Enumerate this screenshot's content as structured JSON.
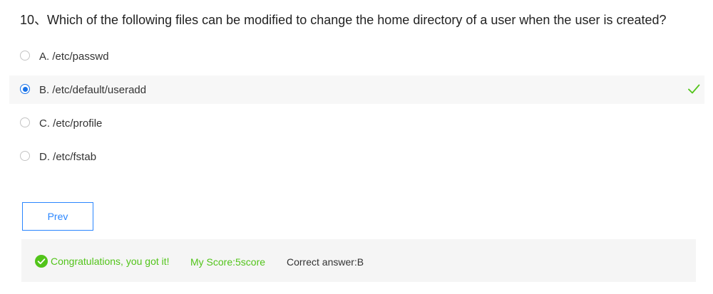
{
  "question": {
    "text": "10、Which of the following files can be modified to change the home directory of a user when the user is created?"
  },
  "options": [
    {
      "label": "A. /etc/passwd",
      "selected": false
    },
    {
      "label": "B. /etc/default/useradd",
      "selected": true,
      "correct_mark": true
    },
    {
      "label": "C. /etc/profile",
      "selected": false
    },
    {
      "label": "D. /etc/fstab",
      "selected": false
    }
  ],
  "prev_button": {
    "label": "Prev"
  },
  "result": {
    "message": "Congratulations, you got it!",
    "score": "My Score:5score",
    "correct_answer": "Correct answer:B"
  },
  "colors": {
    "accent_blue": "#2a86ff",
    "radio_blue": "#1a73e8",
    "success_green": "#52c41a",
    "selected_row_bg": "#f7f7f7",
    "result_bg": "#f5f5f5"
  },
  "icons": {
    "check": "check-icon",
    "success": "check-circle-icon"
  }
}
